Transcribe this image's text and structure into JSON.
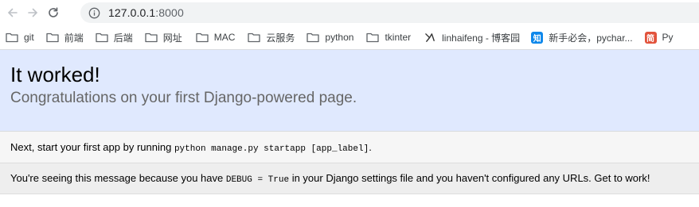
{
  "browser": {
    "url_host": "127.0.0.1",
    "url_port": ":8000",
    "bookmarks": [
      {
        "label": "git",
        "type": "folder"
      },
      {
        "label": "前端",
        "type": "folder"
      },
      {
        "label": "后端",
        "type": "folder"
      },
      {
        "label": "网址",
        "type": "folder"
      },
      {
        "label": "MAC",
        "type": "folder"
      },
      {
        "label": "云服务",
        "type": "folder"
      },
      {
        "label": "python",
        "type": "folder"
      },
      {
        "label": "tkinter",
        "type": "folder"
      },
      {
        "label": "linhaifeng - 博客园",
        "type": "site"
      },
      {
        "label": "新手必会，pychar...",
        "type": "site",
        "favicon_text": "知"
      },
      {
        "label": "Py",
        "type": "site",
        "favicon_text": "简"
      }
    ]
  },
  "page": {
    "title": "It worked!",
    "subtitle": "Congratulations on your first Django-powered page.",
    "next_prefix": "Next, start your first app by running ",
    "next_code": "python manage.py startapp [app_label]",
    "next_suffix": ".",
    "explain_prefix": "You're seeing this message because you have ",
    "explain_code": "DEBUG = True",
    "explain_suffix": " in your Django settings file and you haven't configured any URLs. Get to work!"
  },
  "colors": {
    "header_bg": "#e0e9fe",
    "next_bg": "#f6f6f6",
    "explain_bg": "#eeeeee",
    "omnibox_bg": "#f1f3f4"
  }
}
